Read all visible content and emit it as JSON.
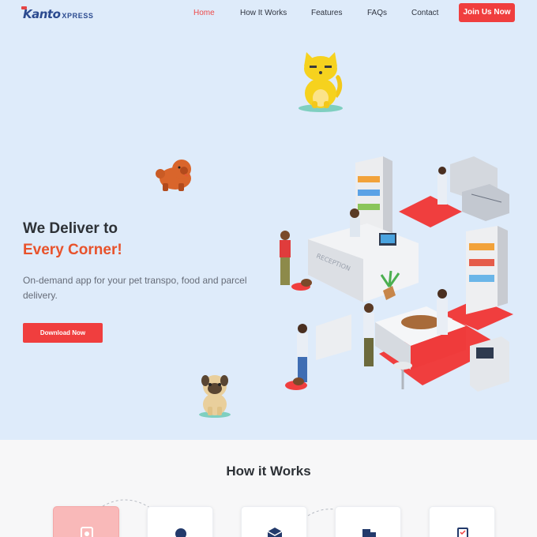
{
  "brand": {
    "logo_main": "Kanto",
    "logo_sub": "XPRESS"
  },
  "nav": {
    "items": [
      {
        "label": "Home",
        "active": true
      },
      {
        "label": "How It Works",
        "active": false
      },
      {
        "label": "Features",
        "active": false
      },
      {
        "label": "FAQs",
        "active": false
      },
      {
        "label": "Contact",
        "active": false
      }
    ],
    "cta_label": "Join Us Now"
  },
  "hero": {
    "headline": "We Deliver to",
    "headline_accent": "Every Corner!",
    "subtext": "On-demand app for your pet transpo, food and parcel delivery.",
    "cta_label": "Download Now",
    "illustration_sign": "RECEPTION"
  },
  "how_it_works": {
    "title": "How it Works",
    "steps": [
      {
        "icon": "phone-app-icon",
        "active": true
      },
      {
        "icon": "user-pin-icon",
        "active": false
      },
      {
        "icon": "package-box-icon",
        "active": false
      },
      {
        "icon": "truck-delivery-icon",
        "active": false
      },
      {
        "icon": "invoice-check-icon",
        "active": false
      }
    ]
  },
  "colors": {
    "accent": "#f03e3e",
    "accent_text": "#e8522b",
    "hero_bg": "#deebfa",
    "brand": "#2b4a8f"
  }
}
